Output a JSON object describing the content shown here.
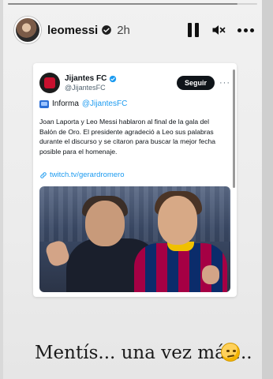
{
  "story": {
    "progress_fraction": 0.92,
    "username": "leomessi",
    "time_ago": "2h"
  },
  "tweet": {
    "account_name": "Jijantes FC",
    "handle": "@JijantesFC",
    "follow_label": "Seguir",
    "more_label": "···",
    "info_label": "Informa",
    "info_mention": "@JijantesFC",
    "text": "Joan Laporta y Leo Messi hablaron al final de la gala del Balón de Oro. El presidente agradeció a Leo sus palabras  durante el discurso y se citaron para buscar la mejor fecha posible para el homenaje.",
    "link": "twitch.tv/gerardromero"
  },
  "caption": {
    "text": "Mentís... una vez más...",
    "emoji": "thinking-worried-face"
  },
  "colors": {
    "link_blue": "#1d9bf0",
    "verified_blue": "#1d9bf0",
    "follow_button_bg": "#0f1419"
  }
}
